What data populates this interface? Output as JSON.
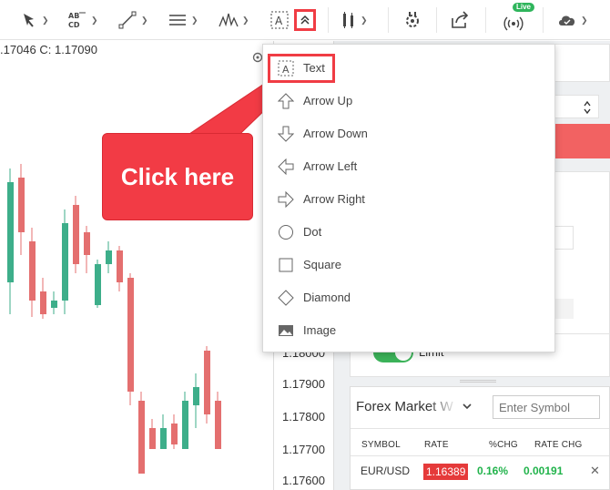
{
  "toolbar": {
    "tools": [
      {
        "icon": "cursor-icon"
      },
      {
        "icon": "text-abcd-icon"
      },
      {
        "icon": "trendline-icon"
      },
      {
        "icon": "horizontal-lines-icon"
      },
      {
        "icon": "pattern-icon"
      },
      {
        "icon": "text-annotation-icon"
      },
      {
        "icon": "collapse-chevron-icon"
      },
      {
        "icon": "indicators-icon"
      },
      {
        "icon": "settings-gear-icon"
      },
      {
        "icon": "share-icon"
      },
      {
        "icon": "live-broadcast-icon"
      },
      {
        "icon": "cloud-icon"
      }
    ],
    "live_badge": "Live",
    "highlight_color": "#f03c44"
  },
  "chart": {
    "ohlc_text": ".17046  C: 1.17090",
    "y_ticks": [
      "1.18000",
      "1.17900",
      "1.17800",
      "1.17700",
      "1.17600"
    ],
    "up_color": "#3dae8a",
    "down_color": "#e46f6f"
  },
  "callout": {
    "text": "Click here",
    "color": "#f23b45"
  },
  "dropdown": {
    "items": [
      {
        "label": "Text",
        "icon": "text-box-icon"
      },
      {
        "label": "Arrow Up",
        "icon": "arrow-up-icon"
      },
      {
        "label": "Arrow Down",
        "icon": "arrow-down-icon"
      },
      {
        "label": "Arrow Left",
        "icon": "arrow-left-icon"
      },
      {
        "label": "Arrow Right",
        "icon": "arrow-right-icon"
      },
      {
        "label": "Dot",
        "icon": "dot-icon"
      },
      {
        "label": "Square",
        "icon": "square-icon"
      },
      {
        "label": "Diamond",
        "icon": "diamond-icon"
      },
      {
        "label": "Image",
        "icon": "image-icon"
      }
    ]
  },
  "order_panel": {
    "limit_label": "Limit",
    "limit_toggle_on": true
  },
  "forex": {
    "title": "Forex Market W",
    "symbol_placeholder": "Enter Symbol",
    "columns": [
      "SYMBOL",
      "RATE",
      "%CHG",
      "RATE CHG"
    ],
    "rows": [
      {
        "symbol": "EUR/USD",
        "rate": "1.16389",
        "pct_chg": "0.16%",
        "rate_chg": "0.00191"
      }
    ]
  }
}
